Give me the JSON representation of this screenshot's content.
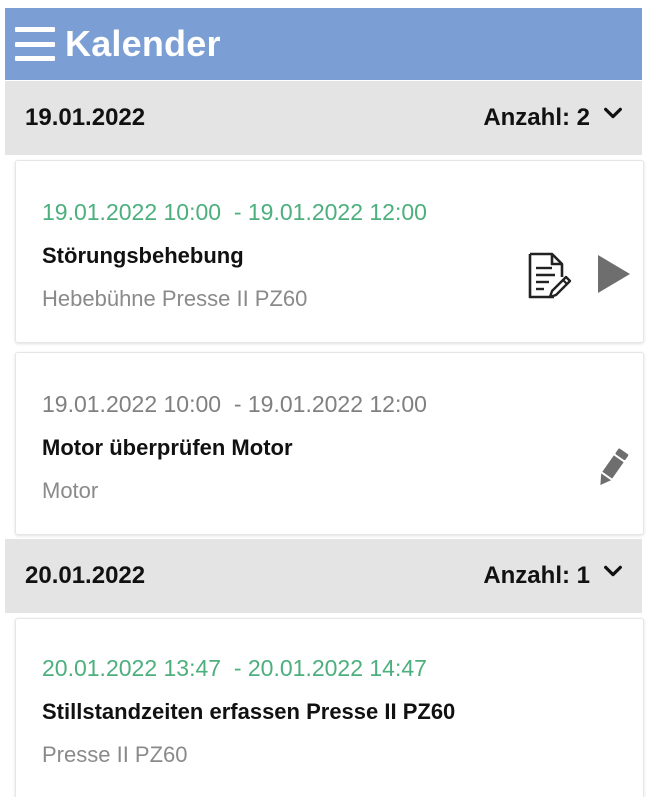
{
  "header": {
    "title": "Kalender",
    "color": "#7b9fd4"
  },
  "groups": [
    {
      "date": "19.01.2022",
      "count_label": "Anzahl: 2",
      "entries": [
        {
          "time_range": "19.01.2022 10:00  - 19.01.2022 12:00",
          "title": "Störungsbehebung",
          "subtitle": "Hebebühne Presse II PZ60",
          "time_color": "#4caf7d",
          "icons": [
            "document-edit-icon",
            "play-icon"
          ]
        },
        {
          "time_range": "19.01.2022 10:00  - 19.01.2022 12:00",
          "title": "Motor überprüfen Motor",
          "subtitle": "Motor",
          "time_color": "#808080",
          "icons": [
            "pencil-icon"
          ]
        }
      ]
    },
    {
      "date": "20.01.2022",
      "count_label": "Anzahl: 1",
      "entries": [
        {
          "time_range": "20.01.2022 13:47  - 20.01.2022 14:47",
          "title": "Stillstandzeiten erfassen Presse II PZ60",
          "subtitle": "Presse II PZ60",
          "time_color": "#4caf7d",
          "icons": []
        }
      ]
    }
  ]
}
